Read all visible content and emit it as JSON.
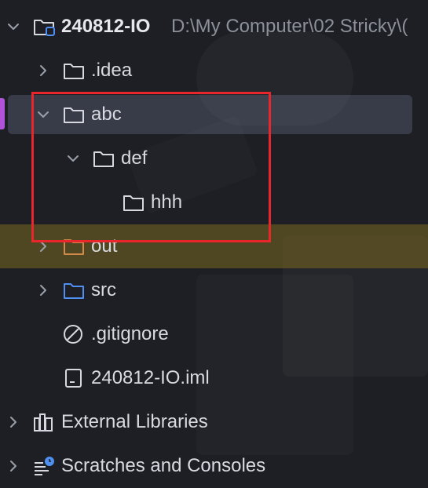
{
  "colors": {
    "background": "#1e1f25",
    "selection": "#4a4f63",
    "selection_marker": "#b153d9",
    "excluded_highlight": "#6b5c1c",
    "folder_icon": "#d5d8de",
    "excluded_folder_icon": "#d08a4a",
    "source_folder_icon": "#4f8ff0",
    "highlight_box": "#e8262b"
  },
  "tree": {
    "project": {
      "name": "240812-IO",
      "path": "D:\\My Computer\\02 Stricky\\(",
      "icon": "module-folder-icon",
      "expanded": true
    },
    "items": [
      {
        "id": "idea",
        "label": ".idea",
        "icon": "folder-icon",
        "expanded": false
      },
      {
        "id": "abc",
        "label": "abc",
        "icon": "folder-icon",
        "expanded": true,
        "selected": true
      },
      {
        "id": "def",
        "label": "def",
        "icon": "folder-icon",
        "expanded": true
      },
      {
        "id": "hhh",
        "label": "hhh",
        "icon": "folder-icon"
      },
      {
        "id": "out",
        "label": "out",
        "icon": "excluded-folder-icon",
        "expanded": false
      },
      {
        "id": "src",
        "label": "src",
        "icon": "source-folder-icon",
        "expanded": false
      },
      {
        "id": "gitignore",
        "label": ".gitignore",
        "icon": "ignored-file-icon"
      },
      {
        "id": "iml",
        "label": "240812-IO.iml",
        "icon": "module-file-icon"
      }
    ],
    "external_libraries": {
      "label": "External Libraries",
      "icon": "libraries-icon",
      "expanded": false
    },
    "scratches": {
      "label": "Scratches and Consoles",
      "icon": "scratches-icon",
      "expanded": false
    }
  }
}
